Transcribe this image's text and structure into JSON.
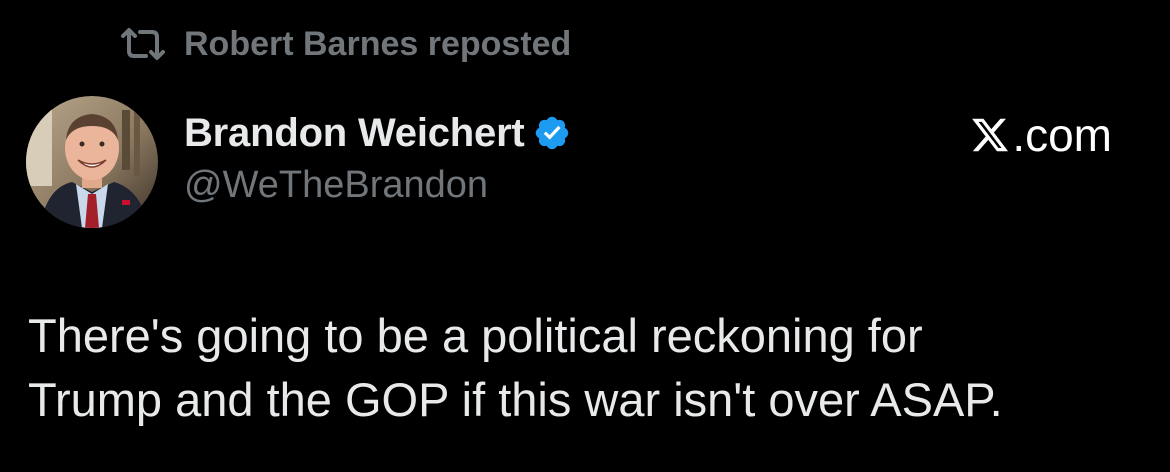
{
  "repost": {
    "text": "Robert Barnes reposted",
    "icon": "repost-icon"
  },
  "author": {
    "display_name": "Brandon Weichert",
    "handle": "@WeTheBrandon",
    "verified": true,
    "verified_color": "#1d9bf0",
    "avatar_icon": "avatar-photo"
  },
  "watermark": {
    "domain": ".com",
    "logo_icon": "x-logo-icon"
  },
  "post": {
    "text": "There's going to be a political reckoning for\nTrump and the GOP if this war isn't over ASAP."
  },
  "colors": {
    "background": "#000000",
    "primary_text": "#e7e9ea",
    "secondary_text": "#71767b",
    "accent": "#1d9bf0"
  }
}
